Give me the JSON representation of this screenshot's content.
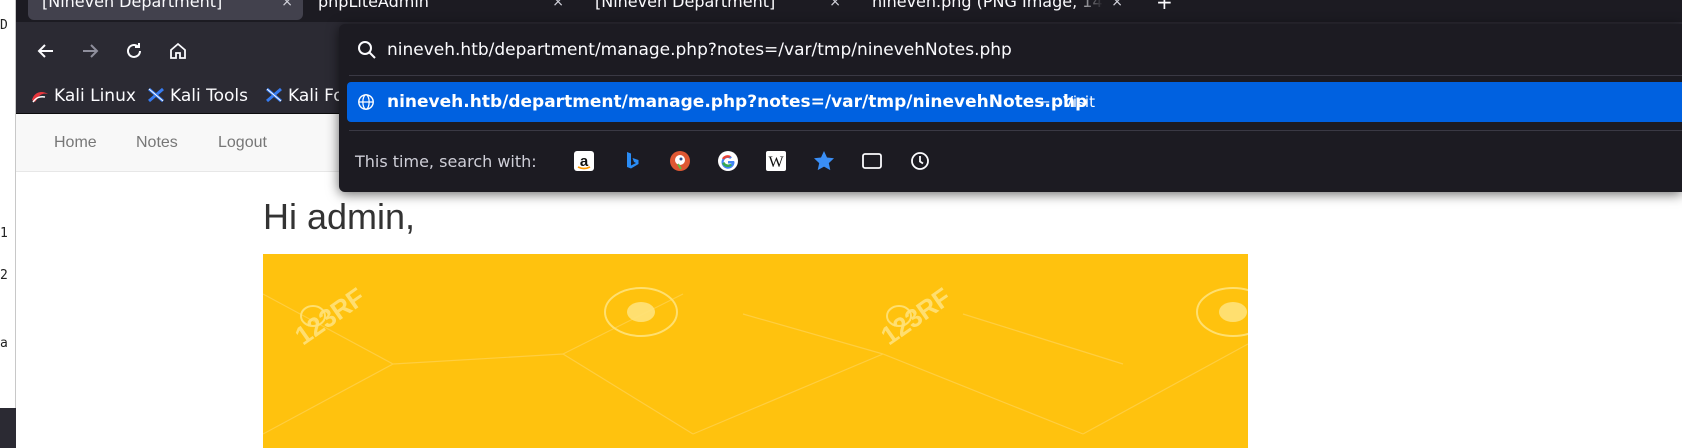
{
  "terminal": {
    "fragments": [
      "D",
      "1",
      "2",
      "a"
    ]
  },
  "tabs": [
    {
      "label": "[Nineveh Department]",
      "active": true
    },
    {
      "label": "phpLiteAdmin",
      "active": false
    },
    {
      "label": "[Nineveh Department]",
      "active": false
    },
    {
      "label": "nineveh.png (PNG Image, 14",
      "active": false
    }
  ],
  "tab_close_glyph": "×",
  "new_tab_glyph": "+",
  "bookmarks": [
    {
      "label": "Kali Linux"
    },
    {
      "label": "Kali Tools"
    },
    {
      "label": "Kali Fo"
    }
  ],
  "address_bar": {
    "value": "nineveh.htb/department/manage.php?notes=/var/tmp/ninevehNotes.php"
  },
  "suggestion": {
    "url": "nineveh.htb/department/manage.php?notes=/var/tmp/ninevehNotes.php",
    "separator": "—",
    "action": "Visit"
  },
  "search_with_label": "This time, search with:",
  "search_engines": [
    "amazon",
    "bing",
    "duckduckgo",
    "google",
    "wikipedia",
    "bookmarks",
    "tabs",
    "history"
  ],
  "site_nav": [
    "Home",
    "Notes",
    "Logout"
  ],
  "greeting": "Hi admin,",
  "banner": {
    "color": "#ffc20e",
    "watermark": "123RF"
  },
  "colors": {
    "accent": "#0061e0",
    "chrome_dark": "#1c1b22",
    "toolbar": "#2b2a33"
  }
}
